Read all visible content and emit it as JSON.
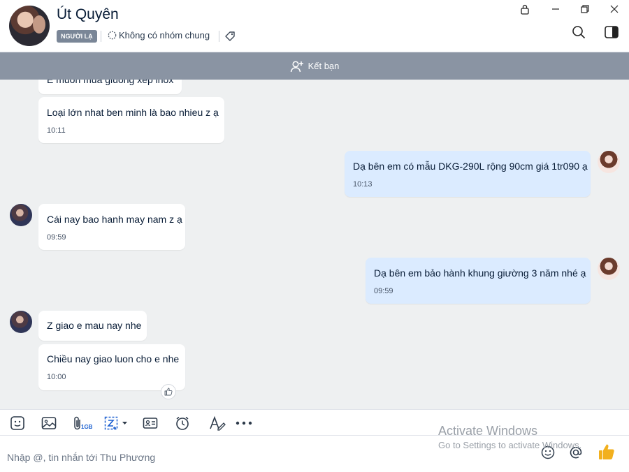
{
  "header": {
    "contact_name": "Út Quyên",
    "stranger_badge": "NGƯỜI LẠ",
    "group_info": "Không có nhóm chung"
  },
  "friend_bar": {
    "label": "Kết bạn"
  },
  "messages": [
    {
      "text": "E muon mua giuong xep inox",
      "from": "them"
    },
    {
      "text": "Loại lớn nhat ben minh là bao nhieu z ạ",
      "time": "10:11",
      "from": "them"
    },
    {
      "text": "Dạ bên em có mẫu DKG-290L rộng 90cm giá 1tr090 ạ",
      "time": "10:13",
      "from": "me"
    },
    {
      "text": "Cái nay bao hanh may nam z ạ",
      "time": "09:59",
      "from": "them"
    },
    {
      "text": "Dạ bên em bảo hành khung giường 3 năm nhé ạ",
      "time": "09:59",
      "from": "me"
    },
    {
      "text": "Z giao e mau nay nhe",
      "from": "them"
    },
    {
      "text": "Chiều nay giao luon cho e nhe",
      "time": "10:00",
      "from": "them"
    }
  ],
  "toolbar": {
    "file_size_badge": "1GB",
    "icons": [
      "sticker-icon",
      "image-icon",
      "attach-icon",
      "screenshot-icon",
      "contact-card-icon",
      "reminder-icon",
      "text-format-icon",
      "more-icon"
    ]
  },
  "composer": {
    "placeholder": "Nhập @, tin nhắn tới Thu Phương"
  },
  "watermark": {
    "line1": "Activate Windows",
    "line2": "Go to Settings to activate Windows."
  },
  "colors": {
    "my_bubble": "#dbebff",
    "their_bubble": "#ffffff",
    "friend_bar": "#8a94a3",
    "chat_background": "#eef0f1",
    "like_accent": "#f2b01e"
  }
}
